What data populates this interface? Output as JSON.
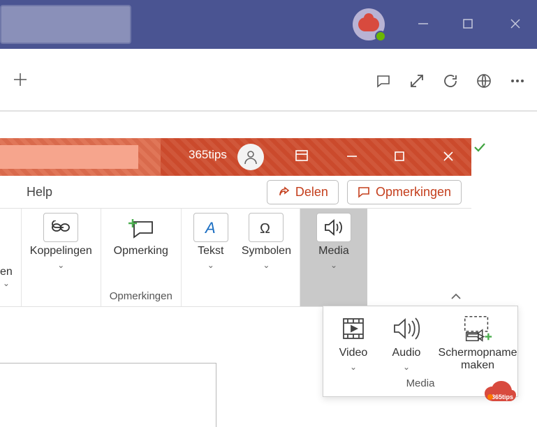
{
  "teams": {
    "window": {
      "minimize_icon": "minimize",
      "maximize_icon": "maximize",
      "close_icon": "close"
    },
    "actions": {
      "add_tab": "+",
      "icons": [
        "comment",
        "expand",
        "refresh",
        "globe",
        "more"
      ]
    }
  },
  "powerpoint": {
    "user": "365tips",
    "tabs": {
      "help": "Help"
    },
    "title_actions": {
      "share": "Delen",
      "comments": "Opmerkingen"
    },
    "ribbon": {
      "partial_group_label": "en",
      "groups": [
        {
          "items": [
            {
              "label": "Koppelingen",
              "icon": "link",
              "has_dropdown": true
            }
          ]
        },
        {
          "caption": "Opmerkingen",
          "items": [
            {
              "label": "Opmerking",
              "icon": "comment-plus",
              "has_dropdown": false
            }
          ]
        },
        {
          "items": [
            {
              "label": "Tekst",
              "icon": "text-a",
              "has_dropdown": true
            },
            {
              "label": "Symbolen",
              "icon": "omega",
              "has_dropdown": true
            }
          ]
        },
        {
          "active": true,
          "items": [
            {
              "label": "Media",
              "icon": "speaker",
              "has_dropdown": true
            }
          ]
        }
      ]
    },
    "media_popup": {
      "caption": "Media",
      "items": [
        {
          "label": "Video",
          "icon": "video",
          "has_dropdown": true
        },
        {
          "label": "Audio",
          "icon": "audio",
          "has_dropdown": true
        },
        {
          "label": "Schermopname\nmaken",
          "icon": "screen-rec",
          "has_dropdown": false
        }
      ]
    }
  },
  "badge": {
    "text": "365tips"
  }
}
